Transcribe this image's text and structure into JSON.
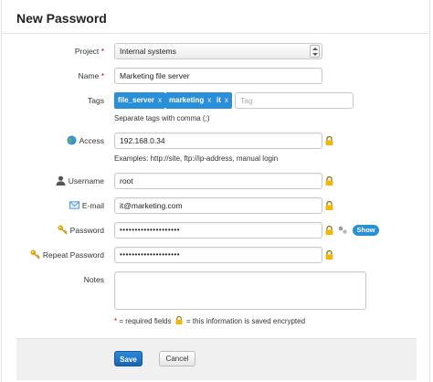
{
  "dialog": {
    "title": "New Password"
  },
  "form": {
    "project": {
      "label": "Project",
      "required_mark": "*",
      "value": "Internal systems"
    },
    "name": {
      "label": "Name",
      "required_mark": "*",
      "value": "Marketing file server"
    },
    "tags": {
      "label": "Tags",
      "items": [
        {
          "label": "file_server",
          "remove": "x"
        },
        {
          "label": "marketing",
          "remove": "x"
        },
        {
          "label": "it",
          "remove": "x"
        }
      ],
      "placeholder": "Tag",
      "hint": "Separate tags with comma (;)"
    },
    "access": {
      "label": "Access",
      "value": "192.168.0.34",
      "hint": "Examples: http://site, ftp://ip-address, manual login"
    },
    "username": {
      "label": "Username",
      "value": "root"
    },
    "email": {
      "label": "E-mail",
      "value": "it@marketing.com"
    },
    "password": {
      "label": "Password",
      "value": "••••••••••••••••••••",
      "show_label": "Show"
    },
    "repeat_password": {
      "label": "Repeat Password",
      "value": "••••••••••••••••••••"
    },
    "notes": {
      "label": "Notes",
      "value": ""
    }
  },
  "legend": {
    "required_mark": "*",
    "required_text": "= required fields",
    "encrypted_text": "= this information is saved encrypted"
  },
  "footer": {
    "save_label": "Save",
    "cancel_label": "Cancel"
  },
  "colors": {
    "accent": "#2a8fd6",
    "required": "#dd0000",
    "lock": "#e0a800"
  }
}
